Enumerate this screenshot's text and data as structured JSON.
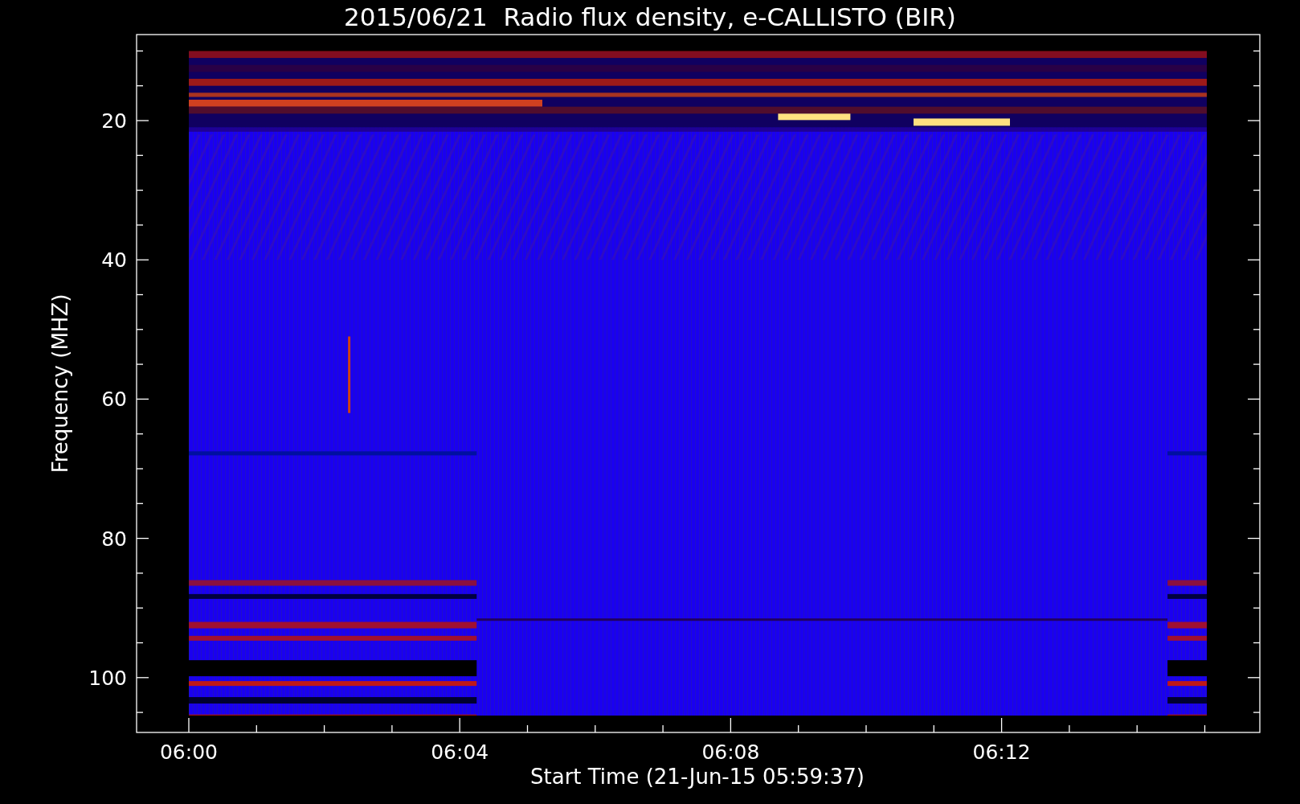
{
  "title": "2015/06/21  Radio flux density, e-CALLISTO (BIR)",
  "spectrogram": {
    "ylabel": "Frequency (MHZ)",
    "xlabel": "Start Time (21-Jun-15 05:59:37)",
    "yticks": [
      "20",
      "40",
      "60",
      "80",
      "100"
    ],
    "xticks": [
      "06:00",
      "06:04",
      "06:08",
      "06:12"
    ]
  }
}
